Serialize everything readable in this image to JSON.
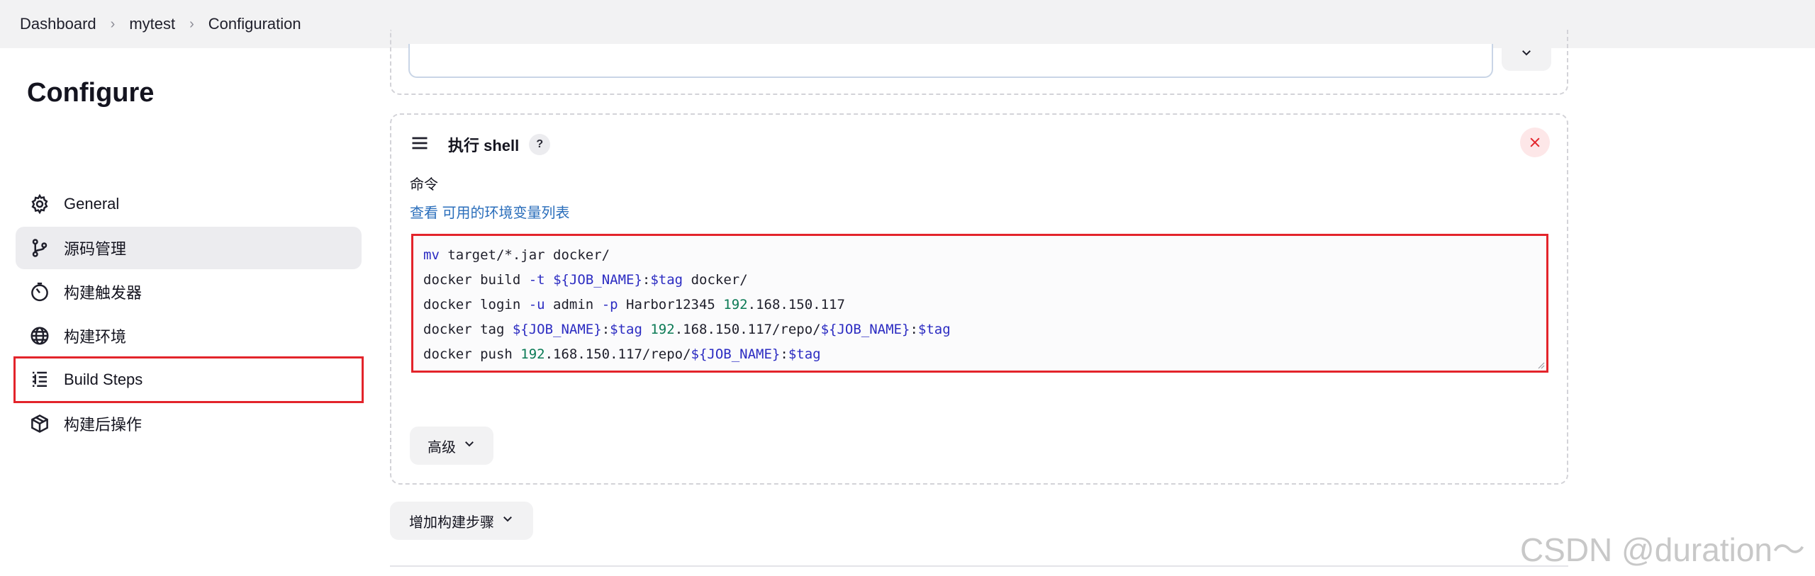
{
  "breadcrumb": [
    "Dashboard",
    "mytest",
    "Configuration"
  ],
  "sidebar": {
    "title": "Configure",
    "items": [
      {
        "label": "General",
        "icon": "gear-icon"
      },
      {
        "label": "源码管理",
        "icon": "source-branch-icon"
      },
      {
        "label": "构建触发器",
        "icon": "timer-icon"
      },
      {
        "label": "构建环境",
        "icon": "globe-icon"
      },
      {
        "label": "Build Steps",
        "icon": "list-steps-icon"
      },
      {
        "label": "构建后操作",
        "icon": "package-icon"
      }
    ]
  },
  "shell_step": {
    "title": "执行 shell",
    "help": "?",
    "command_label": "命令",
    "env_prefix": "查看",
    "env_link": "可用的环境变量列表",
    "code_lines": [
      "mv target/*.jar docker/",
      "docker build -t ${JOB_NAME}:$tag docker/",
      "docker login -u admin -p Harbor12345 192.168.150.117",
      "docker tag ${JOB_NAME}:$tag 192.168.150.117/repo/${JOB_NAME}:$tag",
      "docker push 192.168.150.117/repo/${JOB_NAME}:$tag"
    ],
    "advanced_label": "高级"
  },
  "add_step_label": "增加构建步骤",
  "watermark": "CSDN @duration～",
  "colors": {
    "highlight": "#e3242b",
    "link": "#2a6ebb",
    "keyword": "#2c2cc2",
    "number": "#0b7a55"
  }
}
